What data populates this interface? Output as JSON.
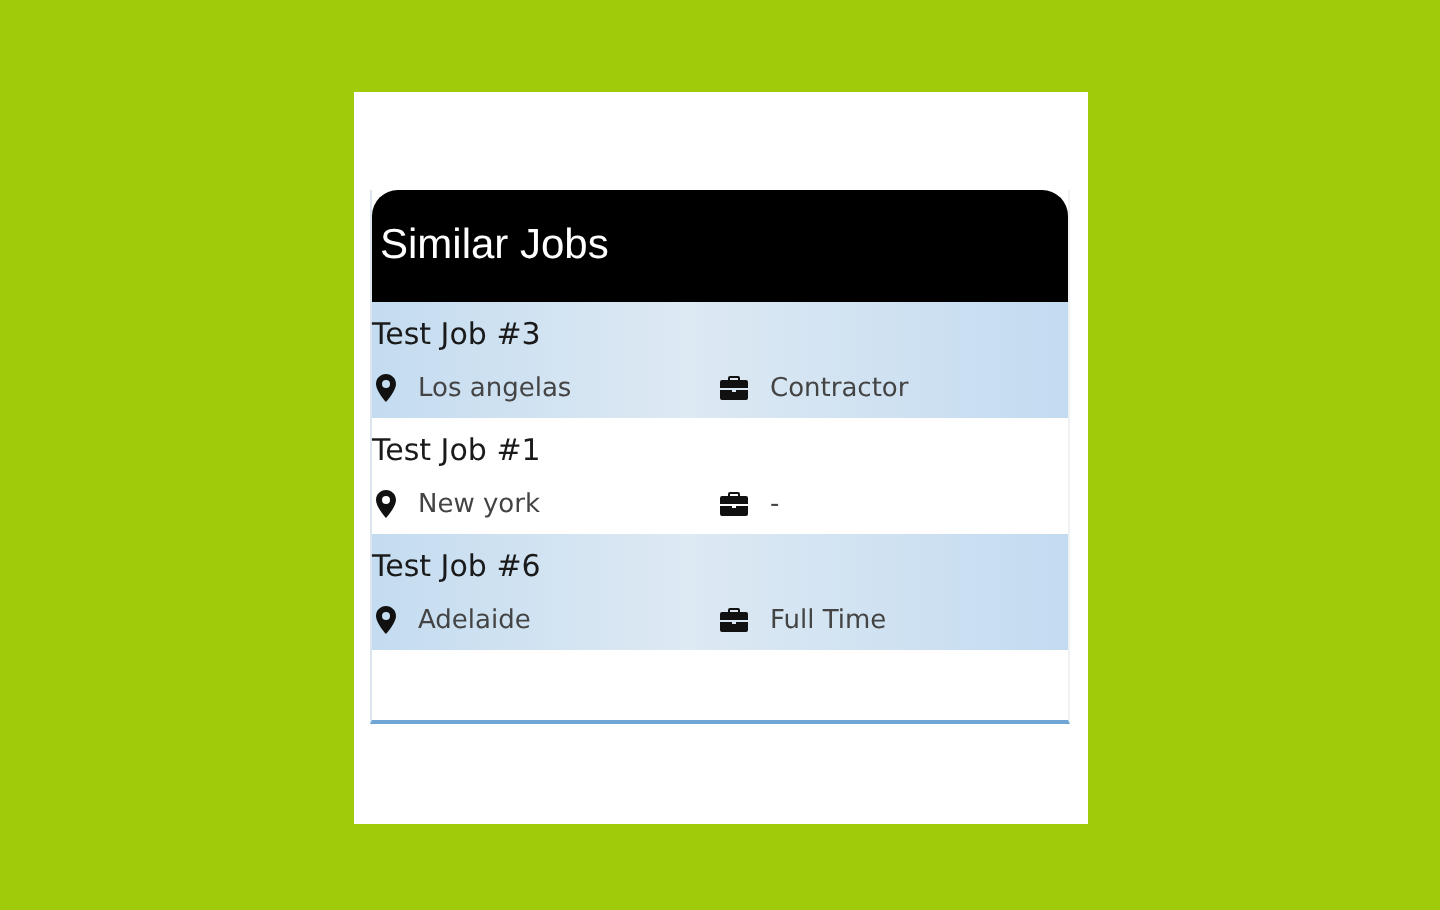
{
  "card": {
    "title": "Similar Jobs"
  },
  "jobs": [
    {
      "title": "Test Job #3",
      "location": "Los angelas",
      "type": "Contractor",
      "highlighted": true
    },
    {
      "title": "Test Job #1",
      "location": "New york",
      "type": "-",
      "highlighted": false
    },
    {
      "title": "Test Job #6",
      "location": "Adelaide",
      "type": "Full Time",
      "highlighted": true
    }
  ]
}
